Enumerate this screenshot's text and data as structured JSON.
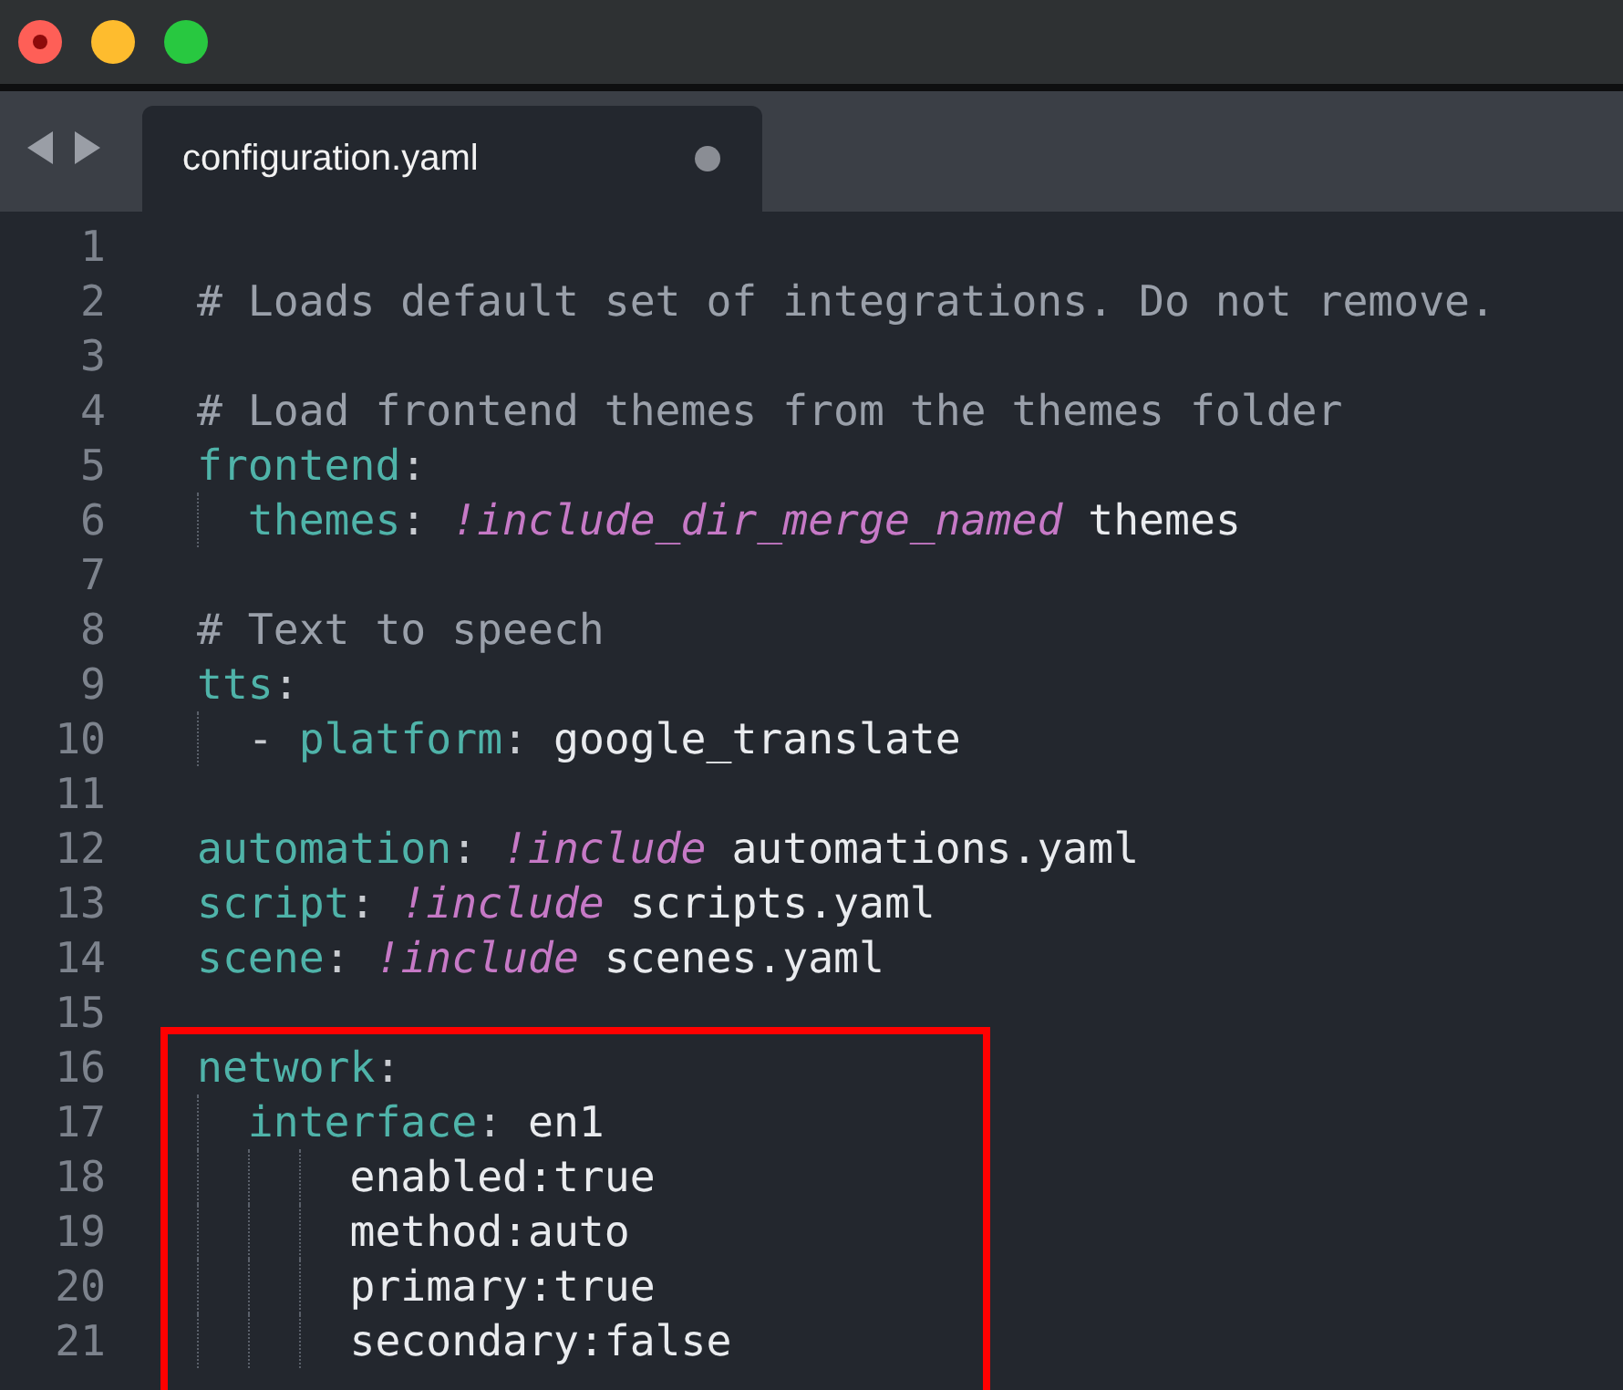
{
  "window": {
    "buttons": [
      {
        "kind": "close"
      },
      {
        "kind": "minimize"
      },
      {
        "kind": "zoom"
      }
    ]
  },
  "tabs": [
    {
      "label": "configuration.yaml",
      "selected": true,
      "modified": true
    }
  ],
  "editor": {
    "lines": [
      {
        "number": "1"
      },
      {
        "number": "2",
        "tokens": [
          {
            "kind": "comment",
            "text": "# Loads default set of integrations. Do not remove."
          }
        ]
      },
      {
        "number": "3"
      },
      {
        "number": "4",
        "tokens": [
          {
            "kind": "comment",
            "text": "# Load frontend themes from the themes folder"
          }
        ]
      },
      {
        "number": "5",
        "tokens": [
          {
            "kind": "key",
            "text": "frontend"
          },
          {
            "kind": "punct",
            "text": ":"
          }
        ]
      },
      {
        "number": "6",
        "tokens": [
          {
            "kind": "key",
            "text": "  themes"
          },
          {
            "kind": "punct",
            "text": ":"
          },
          {
            "kind": "tag",
            "text": " !include_dir_merge_named"
          },
          {
            "kind": "value",
            "text": " themes"
          }
        ]
      },
      {
        "number": "7"
      },
      {
        "number": "8",
        "tokens": [
          {
            "kind": "comment",
            "text": "# Text to speech"
          }
        ]
      },
      {
        "number": "9",
        "tokens": [
          {
            "kind": "key",
            "text": "tts"
          },
          {
            "kind": "punct",
            "text": ":"
          }
        ]
      },
      {
        "number": "10",
        "tokens": [
          {
            "kind": "punct",
            "text": "  -"
          },
          {
            "kind": "key",
            "text": " platform"
          },
          {
            "kind": "punct",
            "text": ":"
          },
          {
            "kind": "value",
            "text": " google_translate"
          }
        ]
      },
      {
        "number": "11"
      },
      {
        "number": "12",
        "tokens": [
          {
            "kind": "key",
            "text": "automation"
          },
          {
            "kind": "punct",
            "text": ":"
          },
          {
            "kind": "tag",
            "text": " !include"
          },
          {
            "kind": "value",
            "text": " automations.yaml"
          }
        ]
      },
      {
        "number": "13",
        "tokens": [
          {
            "kind": "key",
            "text": "script"
          },
          {
            "kind": "punct",
            "text": ":"
          },
          {
            "kind": "tag",
            "text": " !include"
          },
          {
            "kind": "value",
            "text": " scripts.yaml"
          }
        ]
      },
      {
        "number": "14",
        "tokens": [
          {
            "kind": "key",
            "text": "scene"
          },
          {
            "kind": "punct",
            "text": ":"
          },
          {
            "kind": "tag",
            "text": " !include"
          },
          {
            "kind": "value",
            "text": " scenes.yaml"
          }
        ]
      },
      {
        "number": "15"
      },
      {
        "number": "16",
        "tokens": [
          {
            "kind": "key",
            "text": "network"
          },
          {
            "kind": "punct",
            "text": ":"
          }
        ]
      },
      {
        "number": "17",
        "tokens": [
          {
            "kind": "key",
            "text": "  interface"
          },
          {
            "kind": "punct",
            "text": ":"
          },
          {
            "kind": "value",
            "text": " en1"
          }
        ]
      },
      {
        "number": "18",
        "tokens": [
          {
            "kind": "value",
            "text": "      enabled:true"
          }
        ]
      },
      {
        "number": "19",
        "tokens": [
          {
            "kind": "value",
            "text": "      method:auto"
          }
        ]
      },
      {
        "number": "20",
        "tokens": [
          {
            "kind": "value",
            "text": "      primary:true"
          }
        ]
      },
      {
        "number": "21",
        "tokens": [
          {
            "kind": "value",
            "text": "      secondary:false"
          }
        ]
      }
    ]
  }
}
